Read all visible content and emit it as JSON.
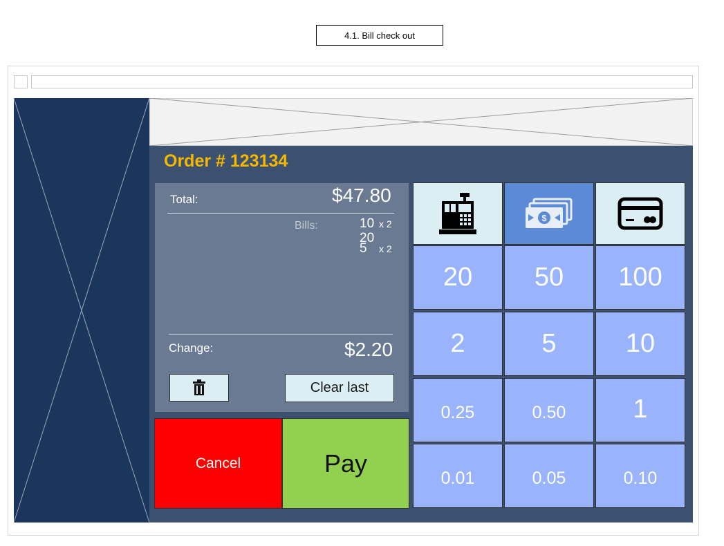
{
  "page": {
    "heading": "4.1. Bill check out"
  },
  "order": {
    "title": "Order # 123134"
  },
  "summary": {
    "total_label": "Total:",
    "total_value": "$47.80",
    "bills_label": "Bills:",
    "bills": [
      {
        "amount": "10",
        "mult": "x 2"
      },
      {
        "amount": "20",
        "mult": ""
      },
      {
        "amount": "5",
        "mult": "x 2"
      }
    ],
    "change_label": "Change:",
    "change_value": "$2.20",
    "clear_last_label": "Clear last"
  },
  "actions": {
    "cancel_label": "Cancel",
    "pay_label": "Pay"
  },
  "payment_methods": [
    {
      "icon": "cash-register-icon",
      "active": false
    },
    {
      "icon": "cash-icon",
      "active": true
    },
    {
      "icon": "credit-card-icon",
      "active": false
    }
  ],
  "keypad": {
    "rows": [
      [
        "20",
        "50",
        "100"
      ],
      [
        "2",
        "5",
        "10"
      ],
      [
        "0.25",
        "0.50",
        "1"
      ],
      [
        "0.01",
        "0.05",
        "0.10"
      ]
    ]
  },
  "colors": {
    "sidebar": "#1b365d",
    "panel": "#3c5070",
    "summary": "#6a7a93",
    "accent_title": "#f5b800",
    "key": "#99b4fc",
    "method_active": "#5b8bd6",
    "cancel": "#ff0000",
    "pay": "#92d050"
  }
}
